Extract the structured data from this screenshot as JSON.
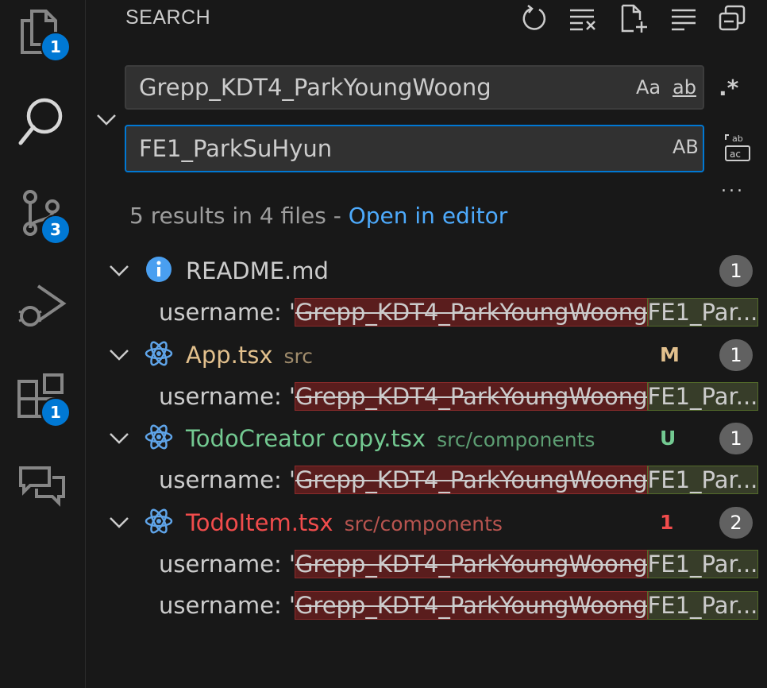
{
  "activity_bar": {
    "explorer_badge": "1",
    "source_control_badge": "3",
    "extensions_badge": "1"
  },
  "view": {
    "title": "SEARCH"
  },
  "search": {
    "query": "Grepp_KDT4_ParkYoungWoong",
    "match_case_label": "Aa",
    "whole_word_label": "ab",
    "regex_label": ".*",
    "replace_value": "FE1_ParkSuHyun",
    "preserve_case_label": "AB",
    "more_label": "..."
  },
  "results": {
    "summary": "5 results in 4 files - ",
    "open_in_editor": "Open in editor",
    "files": [
      {
        "name": "README.md",
        "path": "",
        "decoration": "",
        "count": "1",
        "color": "#cccccc",
        "path_color": "#9d9d9d",
        "icon": "info-icon"
      },
      {
        "name": "App.tsx",
        "path": "src",
        "decoration": "M",
        "count": "1",
        "color": "#e2c08d",
        "path_color": "#a08c6c",
        "icon": "react-icon"
      },
      {
        "name": "TodoCreator copy.tsx",
        "path": "src/components",
        "decoration": "U",
        "count": "1",
        "color": "#73c991",
        "path_color": "#5d9e73",
        "icon": "react-icon"
      },
      {
        "name": "TodoItem.tsx",
        "path": "src/components",
        "decoration": "1",
        "count": "2",
        "color": "#f14c4c",
        "path_color": "#b8544f",
        "icon": "react-icon"
      }
    ],
    "matches": [
      {
        "prefix": "username: '",
        "old": "Grepp_KDT4_ParkYoungWoong",
        "new": "FE1_Par..."
      },
      {
        "prefix": "username: '",
        "old": "Grepp_KDT4_ParkYoungWoong",
        "new": "FE1_Par..."
      },
      {
        "prefix": "username: '",
        "old": "Grepp_KDT4_ParkYoungWoong",
        "new": "FE1_Par..."
      },
      {
        "prefix": "username: '",
        "old": "Grepp_KDT4_ParkYoungWoong",
        "new": "FE1_Par..."
      },
      {
        "prefix": "username: '",
        "old": "Grepp_KDT4_ParkYoungWoong",
        "new": "FE1_Par..."
      }
    ]
  },
  "colors": {
    "accent": "#0078d4",
    "link": "#4daafc",
    "background": "#181818",
    "input_bg": "#313131"
  }
}
